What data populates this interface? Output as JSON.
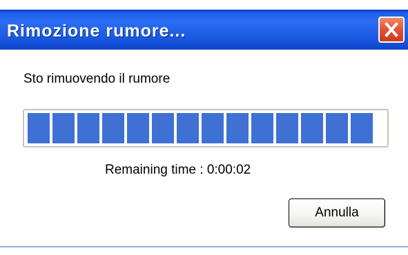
{
  "dialog": {
    "title": "Rimozione rumore...",
    "close_icon": "close-icon",
    "message": "Sto rimuovendo il rumore",
    "progress": {
      "fraction": 0.95,
      "filled_segments": 14
    },
    "remaining_time": "Remaining time : 0:00:02",
    "cancel_label": "Annulla"
  },
  "colors": {
    "titlebar": "#2a6df2",
    "close_button": "#e0583a",
    "progress_fill": "#3f71d4"
  }
}
